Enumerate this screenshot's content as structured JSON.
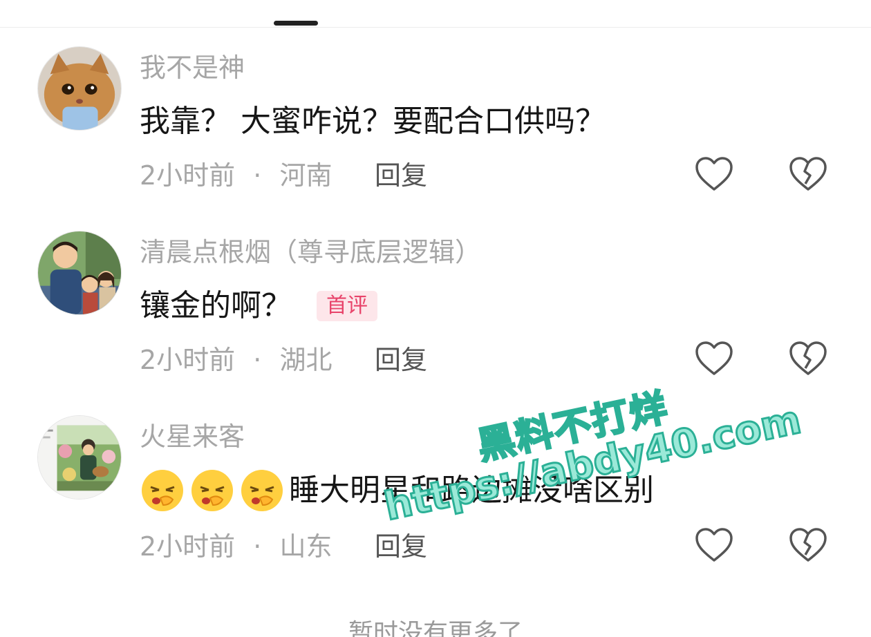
{
  "comments": [
    {
      "username": "我不是神",
      "text": "我靠？ 大蜜咋说？要配合口供吗？",
      "time": "2小时前",
      "separator": "·",
      "location": "河南",
      "reply_label": "回复",
      "avatar_icon": "cat-avatar"
    },
    {
      "username": "清晨点根烟（尊寻底层逻辑）",
      "text": "镶金的啊？",
      "badge": "首评",
      "time": "2小时前",
      "separator": "·",
      "location": "湖北",
      "reply_label": "回复",
      "avatar_icon": "family-illustration-avatar"
    },
    {
      "username": "火星来客",
      "text": "睡大明星和路边摊没啥区别",
      "emojis": [
        "sleepy-yawn-emoji",
        "sleepy-yawn-emoji",
        "sleepy-yawn-emoji"
      ],
      "time": "2小时前",
      "separator": "·",
      "location": "山东",
      "reply_label": "回复",
      "avatar_icon": "garden-illustration-avatar"
    }
  ],
  "footer": {
    "text": "暂时没有更多了"
  },
  "watermark": {
    "line1": "黑料不打烊",
    "line2": "https://abdy40.com"
  },
  "colors": {
    "username": "#a6a6a6",
    "body": "#161616",
    "badge_bg": "#fde6ea",
    "badge_text": "#e8436a",
    "watermark_fill": "#9be9d8",
    "watermark_stroke": "#2bb096"
  }
}
